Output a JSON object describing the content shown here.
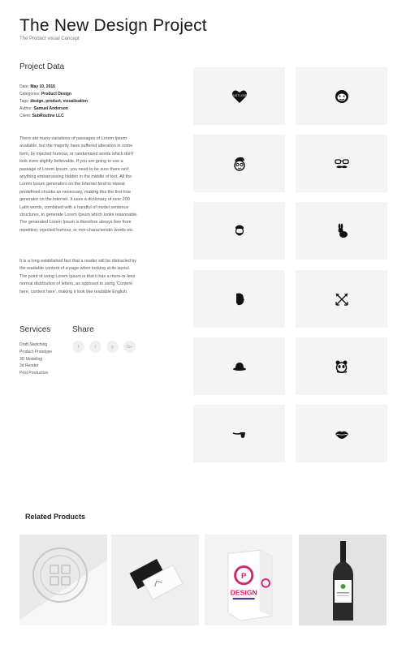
{
  "header": {
    "title": "The New Design Project",
    "subtitle": "The Product visual Concept"
  },
  "project": {
    "heading": "Project Data",
    "meta": [
      {
        "label": "Date: ",
        "value": "May 10, 2016"
      },
      {
        "label": "Categories: ",
        "value": "Product Design"
      },
      {
        "label": "Tags: ",
        "value": "design, product, visualisation"
      },
      {
        "label": "Author: ",
        "value": "Samuel Anderson"
      },
      {
        "label": "Client: ",
        "value": "SubRoutine LLC"
      }
    ],
    "description_1": "There are many variations of passages of Lorem Ipsum available, but the majority have suffered alteration in some form, by injected humour, or randomised words which don't look even slightly believable. If you are going to use a passage of Lorem Ipsum, you need to be sure there isn't anything embarrassing hidden in the middle of text. All the Lorem Ipsum generators on the Internet tend to repeat predefined chunks as necessary, making this the first true generator on the Internet. It uses a dictionary of over 200 Latin words, combined with a handful of model sentence structures, to generate Lorem Ipsum which looks reasonable. The generated Lorem Ipsum is therefore always free from repetition, injected humour, or non-characteristic words etc.",
    "description_2": "It is a long established fact that a reader will be distracted by the readable content of a page when looking at its layout. The point of using Lorem Ipsum is that it has a more-or-less normal distribution of letters, as opposed to using 'Content here, content here', making it look like readable English."
  },
  "services": {
    "heading": "Services",
    "items": [
      "Draft Sketching",
      "Product Prototype",
      "3D Modeling",
      "3d Render",
      "Post Production"
    ]
  },
  "share": {
    "heading": "Share",
    "buttons": [
      {
        "icon": "facebook-icon",
        "glyph": "f"
      },
      {
        "icon": "twitter-icon",
        "glyph": "t"
      },
      {
        "icon": "pinterest-icon",
        "glyph": "p"
      },
      {
        "icon": "google-plus-icon",
        "glyph": "G+"
      }
    ]
  },
  "gallery": {
    "icons": [
      "heart-badge-icon",
      "monkey-face-icon",
      "hipster-face-icon",
      "glasses-mustache-icon",
      "bearded-man-icon",
      "rabbit-icon",
      "bearded-profile-icon",
      "crossed-arrows-icon",
      "bowler-hat-icon",
      "panda-icon",
      "smoking-pipe-icon",
      "lips-icon"
    ],
    "badge_text": "JUST LOVE"
  },
  "related": {
    "heading": "Related Products",
    "products": [
      {
        "name": "stamp-mockup"
      },
      {
        "name": "business-cards-mockup"
      },
      {
        "name": "box-mockup",
        "brand": "DESIGN"
      },
      {
        "name": "wine-bottle-mockup"
      }
    ]
  },
  "colors": {
    "text": "#222222",
    "muted": "#555555",
    "tile_bg": "#f4f4f4",
    "accent_pink": "#d6246e"
  }
}
